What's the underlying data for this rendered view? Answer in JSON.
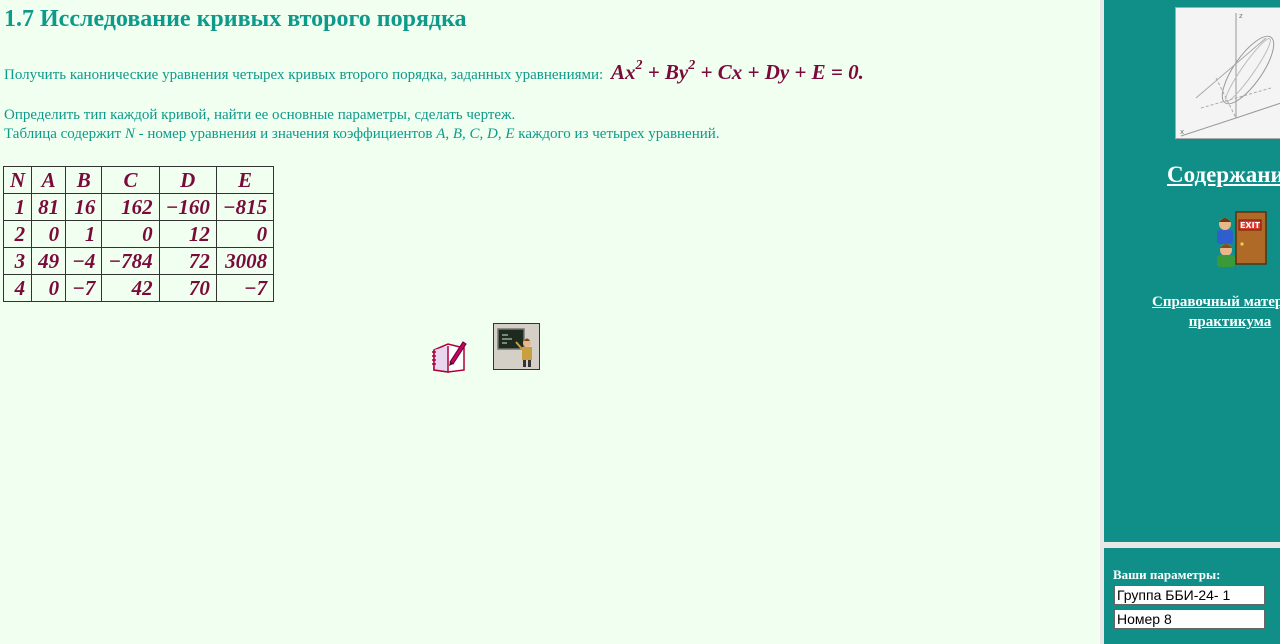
{
  "page": {
    "title": "1.7 Исследование кривых второго порядка",
    "intro": "Получить канонические уравнения четырех кривых второго порядка, заданных уравнениями:",
    "formula": {
      "p1": "Ax",
      "e1": "2",
      "p2": " + By",
      "e2": "2",
      "p3": " + Cx + Dy + E = 0."
    },
    "line2": "Определить тип каждой кривой, найти ее основные параметры, сделать чертеж.",
    "line3": {
      "pre": "Таблица содержит ",
      "n": "N",
      "mid": " - номер уравнения и значения коэффициентов ",
      "letters": "A, B, C, D, E",
      "post": " каждого из четырех уравнений."
    }
  },
  "table": {
    "headers": [
      "N",
      "A",
      "B",
      "C",
      "D",
      "E"
    ],
    "rows": [
      [
        "1",
        "81",
        "16",
        "162",
        "−160",
        "−815"
      ],
      [
        "2",
        "0",
        "1",
        "0",
        "12",
        "0"
      ],
      [
        "3",
        "49",
        "−4",
        "−784",
        "72",
        "3008"
      ],
      [
        "4",
        "0",
        "−7",
        "42",
        "70",
        "−7"
      ]
    ]
  },
  "sidebar": {
    "contents_link": "Содержание",
    "reference_link_line1": "Справочный материал",
    "reference_link_line2": "практикума",
    "params_label": "Ваши параметры:",
    "group_value": "Группа ББИ-24- 1",
    "number_value": "Номер 8"
  },
  "icons": {
    "pen": "notebook-pen-icon",
    "teacher": "teacher-blackboard-icon",
    "exit": "exit-door-icon",
    "thumbnail": "3d-surface-graph"
  },
  "colors": {
    "heading": "#0e9a8a",
    "math": "#7a0a3a",
    "sidebar": "#0f8f88",
    "background": "#f0fff0"
  }
}
